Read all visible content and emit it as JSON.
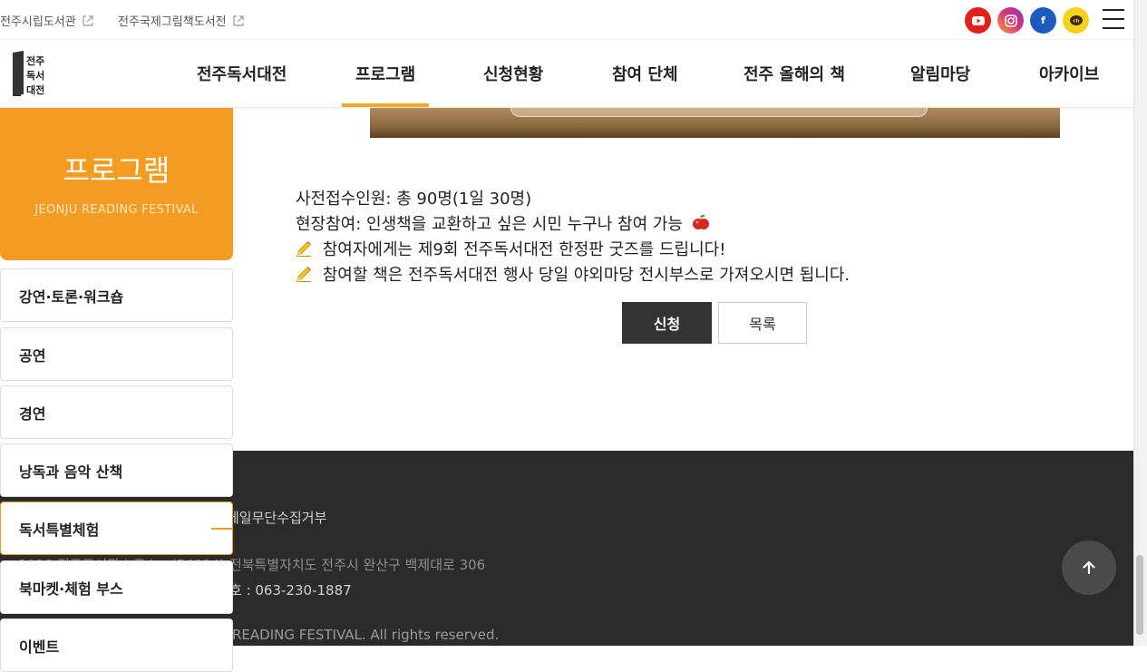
{
  "util_bar": {
    "links": [
      "전주시립도서관",
      "전주국제그림책도서전"
    ],
    "social": [
      {
        "icon": "youtube-icon",
        "color": "#e0211c",
        "glyph": "▶"
      },
      {
        "icon": "instagram-icon",
        "color": "#d6307a",
        "glyph": "◎"
      },
      {
        "icon": "facebook-icon",
        "color": "#1e5bbf",
        "glyph": "f"
      },
      {
        "icon": "kakaotalk-icon",
        "color": "#f7d21b",
        "glyph": "ch"
      }
    ]
  },
  "header": {
    "logo_text": [
      "전주",
      "독서",
      "대전"
    ],
    "nav": [
      "전주독서대전",
      "프로그램",
      "신청현황",
      "참여 단체",
      "전주 올해의 책",
      "알림마당",
      "아카이브"
    ],
    "active_nav": "프로그램"
  },
  "sidebar": {
    "title": "프로그램",
    "subtitle": "JEONJU READING FESTIVAL",
    "items": [
      "강연·토론·워크숍",
      "공연",
      "경연",
      "낭독과 음악 산책",
      "독서특별체험",
      "북마켓·체험 부스",
      "이벤트"
    ],
    "active_item": "독서특별체험"
  },
  "content": {
    "line1": "사전접수인원: 총 90명(1일 30명)",
    "line2": "현장참여: 인생책을 교환하고 싶은 시민 누구나 참여 가능",
    "line3": "참여자에게는 제9회 전주독서대전 한정판 굿즈를 드립니다!",
    "line4": "참여할 책은 전주독서대전 행사 당일 야외마당 전시부스로 가져오시면 됩니다.",
    "apply_button": "신청",
    "list_button": "목록"
  },
  "footer": {
    "line1": "메일무단수집거부",
    "line2": "2026 전주도서관 | 주소 : (54994) 전북특별자치도 전주시 완산구 백제대로 306",
    "line3": "호 : 063-230-1887",
    "line4": "READING FESTIVAL. All rights reserved."
  },
  "colors": {
    "accent": "#f39c21",
    "footer_bg": "#2b2b2b",
    "button_dark": "#333333"
  }
}
